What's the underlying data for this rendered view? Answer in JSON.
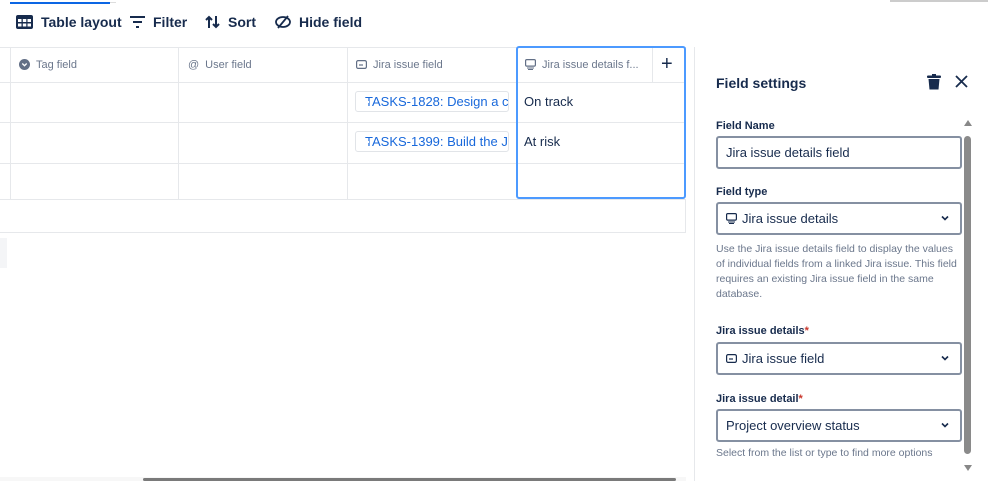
{
  "toolbar": {
    "table_layout": "Table layout",
    "filter": "Filter",
    "sort": "Sort",
    "hide_field": "Hide field"
  },
  "table": {
    "columns": [
      "Tag field",
      "User field",
      "Jira issue field",
      "Jira issue details f..."
    ],
    "rows": [
      {
        "jira_issue": "TASKS-1828: Design a c...",
        "details": "On track"
      },
      {
        "jira_issue": "TASKS-1399: Build the J...",
        "details": "At risk"
      },
      {
        "jira_issue": "",
        "details": ""
      }
    ],
    "add_column": "+"
  },
  "panel": {
    "title": "Field settings",
    "field_name_label": "Field Name",
    "field_name_value": "Jira issue details field",
    "field_type_label": "Field type",
    "field_type_value": "Jira issue details",
    "description": "Use the Jira issue details field to display the values of individual fields from a linked Jira issue. This field requires an existing Jira issue field in the same database.",
    "issue_details_label": "Jira issue details",
    "issue_details_value": "Jira issue field",
    "issue_detail_label": "Jira issue detail",
    "issue_detail_value": "Project overview status",
    "issue_detail_help": "Select from the list or type to find more options",
    "required_mark": "*"
  }
}
